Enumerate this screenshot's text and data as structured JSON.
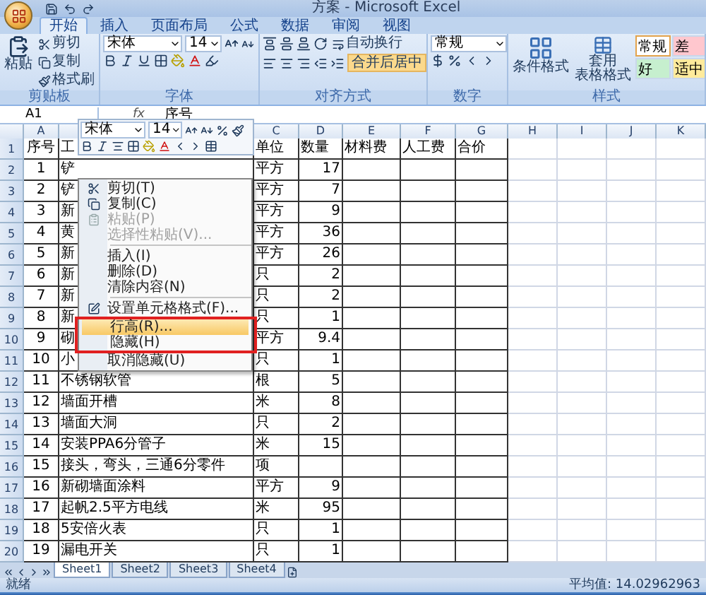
{
  "window": {
    "title": "方案 - Microsoft Excel"
  },
  "ribbon_tabs": [
    {
      "label": "开始",
      "selected": true
    },
    {
      "label": "插入",
      "selected": false
    },
    {
      "label": "页面布局",
      "selected": false
    },
    {
      "label": "公式",
      "selected": false
    },
    {
      "label": "数据",
      "selected": false
    },
    {
      "label": "审阅",
      "selected": false
    },
    {
      "label": "视图",
      "selected": false
    }
  ],
  "ribbon": {
    "groups": [
      {
        "kind": "clipboard",
        "label": "剪贴板",
        "paste": "粘贴",
        "buttons": [
          "剪切",
          "复制",
          "格式刷"
        ]
      },
      {
        "kind": "font",
        "label": "字体",
        "font": "宋体",
        "size": "14"
      },
      {
        "kind": "alignment",
        "label": "对齐方式",
        "wrap": "自动换行",
        "merge": "合并后居中"
      },
      {
        "kind": "number",
        "label": "数字",
        "format": "常规"
      },
      {
        "kind": "styles",
        "label": "样式",
        "conditional": "条件格式",
        "table_format": [
          "套用",
          "表格格式"
        ],
        "cell_styles": [
          {
            "label": "常规",
            "color": "#ffffff"
          },
          {
            "label": "差",
            "color": "#ffc7ce"
          },
          {
            "label": "好",
            "color": "#c6efce"
          },
          {
            "label": "适中",
            "color": "#ffeb9c"
          }
        ]
      }
    ]
  },
  "formula_bar": {
    "name_box": "A1",
    "function_label": "fx",
    "value": "序号"
  },
  "sheet": {
    "columns": [
      {
        "label": "A"
      },
      {},
      {
        "label": "C"
      },
      {
        "label": "D"
      },
      {
        "label": "E"
      },
      {
        "label": "F"
      },
      {
        "label": "G"
      },
      {
        "label": "H"
      },
      {
        "label": "I"
      },
      {
        "label": "J"
      },
      {
        "label": "K"
      }
    ],
    "rows": [
      {
        "number": "1",
        "cells": [
          "序号",
          "工",
          "单位",
          "数量",
          "材料费",
          "人工费",
          "合价"
        ]
      },
      {
        "number": "2",
        "cells": [
          "1",
          "铲",
          "平方",
          "17"
        ]
      },
      {
        "number": "3",
        "cells": [
          "2",
          "铲",
          "平方",
          "7"
        ]
      },
      {
        "number": "4",
        "cells": [
          "3",
          "新",
          "平方",
          "9"
        ]
      },
      {
        "number": "5",
        "cells": [
          "4",
          "黄",
          "平方",
          "36"
        ]
      },
      {
        "number": "6",
        "cells": [
          "5",
          "新",
          "平方",
          "26"
        ]
      },
      {
        "number": "7",
        "cells": [
          "6",
          "新",
          "只",
          "2"
        ]
      },
      {
        "number": "8",
        "cells": [
          "7",
          "新",
          "只",
          "2"
        ]
      },
      {
        "number": "9",
        "cells": [
          "8",
          "新",
          "只",
          "1"
        ]
      },
      {
        "number": "10",
        "cells": [
          "9",
          "砌",
          "平方",
          "9.4"
        ]
      },
      {
        "number": "11",
        "cells": [
          "10",
          "小",
          "只",
          "1"
        ]
      },
      {
        "number": "12",
        "cells": [
          "11",
          "不锈钢软管",
          "根",
          "5"
        ]
      },
      {
        "number": "13",
        "cells": [
          "12",
          "墙面开槽",
          "米",
          "8"
        ]
      },
      {
        "number": "14",
        "cells": [
          "13",
          "墙面大洞",
          "只",
          "2"
        ]
      },
      {
        "number": "15",
        "cells": [
          "14",
          "安装PPA6分管子",
          "米",
          "15"
        ]
      },
      {
        "number": "16",
        "cells": [
          "15",
          "接头，弯头，三通6分零件",
          "项"
        ]
      },
      {
        "number": "17",
        "cells": [
          "16",
          "新砌墙面涂料",
          "平方",
          "9"
        ]
      },
      {
        "number": "18",
        "cells": [
          "17",
          "起帆2.5平方电线",
          "米",
          "95"
        ]
      },
      {
        "number": "19",
        "cells": [
          "18",
          "5安倍火表",
          "只",
          "1"
        ]
      },
      {
        "number": "20",
        "cells": [
          "19",
          "漏电开关",
          "只",
          "1"
        ]
      }
    ]
  },
  "mini_toolbar": {
    "font": "宋体",
    "size": "14"
  },
  "context_menu": {
    "items": [
      {
        "kind": "cut",
        "label": "剪切(T)",
        "disabled": false,
        "selected": false
      },
      {
        "kind": "copy",
        "label": "复制(C)",
        "disabled": false,
        "selected": false
      },
      {
        "kind": "paste",
        "label": "粘贴(P)",
        "disabled": true,
        "selected": false
      },
      {
        "kind": "plain",
        "label": "选择性粘贴(V)...",
        "disabled": true,
        "selected": false
      },
      {
        "kind": "separator"
      },
      {
        "kind": "plain",
        "label": "插入(I)",
        "disabled": false,
        "selected": false
      },
      {
        "kind": "plain",
        "label": "删除(D)",
        "disabled": false,
        "selected": false
      },
      {
        "kind": "plain",
        "label": "清除内容(N)",
        "disabled": false,
        "selected": false
      },
      {
        "kind": "separator"
      },
      {
        "kind": "format",
        "label": "设置单元格格式(F)...",
        "disabled": false,
        "selected": false
      },
      {
        "kind": "plain",
        "label": "行高(R)...",
        "disabled": false,
        "selected": true,
        "annotated": true
      },
      {
        "kind": "plain",
        "label": "隐藏(H)",
        "disabled": false,
        "selected": false,
        "annotated": true
      },
      {
        "kind": "plain",
        "label": "取消隐藏(U)",
        "disabled": false,
        "selected": false
      }
    ]
  },
  "sheet_tabs": [
    {
      "label": "Sheet1",
      "selected": true
    },
    {
      "label": "Sheet2",
      "selected": false
    },
    {
      "label": "Sheet3",
      "selected": false
    },
    {
      "label": "Sheet4",
      "selected": false
    }
  ],
  "status_bar": {
    "status": "就绪",
    "average": "平均值: 14.02962963"
  }
}
